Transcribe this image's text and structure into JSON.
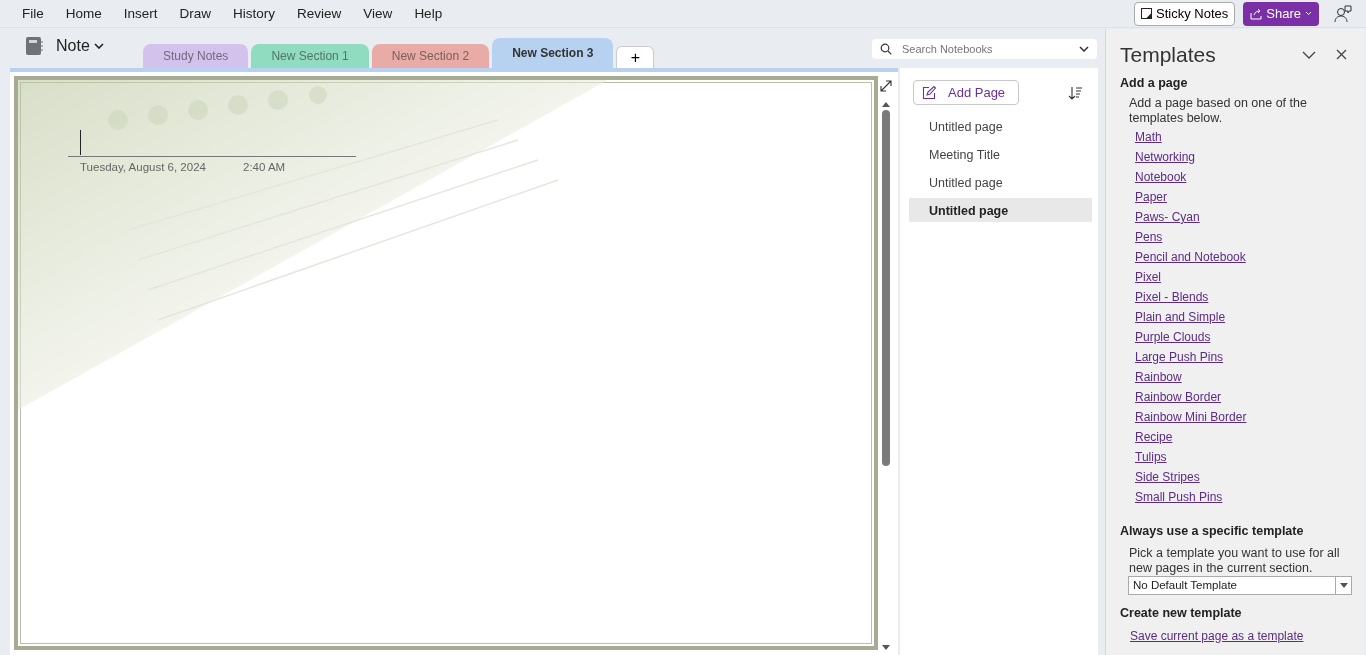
{
  "menu": [
    {
      "label": "File"
    },
    {
      "label": "Home"
    },
    {
      "label": "Insert"
    },
    {
      "label": "Draw"
    },
    {
      "label": "History"
    },
    {
      "label": "Review"
    },
    {
      "label": "View"
    },
    {
      "label": "Help"
    }
  ],
  "top_buttons": {
    "sticky_notes": "Sticky Notes",
    "share": "Share"
  },
  "notebook": {
    "name": "Note"
  },
  "section_tabs": [
    {
      "label": "Study Notes",
      "color": "#d3c2ec",
      "selected": false
    },
    {
      "label": "New Section 1",
      "color": "#8fdcc0",
      "selected": false
    },
    {
      "label": "New Section 2",
      "color": "#e8aba5",
      "selected": false
    },
    {
      "label": "New Section 3",
      "color": "#b6d2f0",
      "selected": true
    }
  ],
  "add_section": "+",
  "search": {
    "placeholder": "Search Notebooks"
  },
  "page": {
    "date": "Tuesday, August 6, 2024",
    "time": "2:40 AM"
  },
  "page_list": {
    "add_button": "Add Page",
    "pages": [
      {
        "title": "Untitled page",
        "selected": false
      },
      {
        "title": "Meeting Title",
        "selected": false
      },
      {
        "title": "Untitled page",
        "selected": false
      },
      {
        "title": "Untitled page",
        "selected": true
      }
    ]
  },
  "templates_pane": {
    "title": "Templates",
    "add_heading": "Add a page",
    "add_description": "Add a page based on one of the templates below.",
    "templates": [
      "Math",
      "Networking",
      "Notebook",
      "Paper",
      "Paws- Cyan",
      "Pens",
      "Pencil and Notebook",
      "Pixel",
      "Pixel - Blends",
      "Plain and Simple",
      "Purple Clouds",
      "Large Push Pins",
      "Rainbow",
      "Rainbow Border",
      "Rainbow Mini Border",
      "Recipe",
      "Tulips",
      "Side Stripes",
      "Small Push Pins"
    ],
    "default_heading": "Always use a specific template",
    "default_description": "Pick a template you want to use for all new pages in the current section.",
    "default_value": "No Default Template",
    "create_heading": "Create new template",
    "create_link": "Save current page as a template"
  }
}
